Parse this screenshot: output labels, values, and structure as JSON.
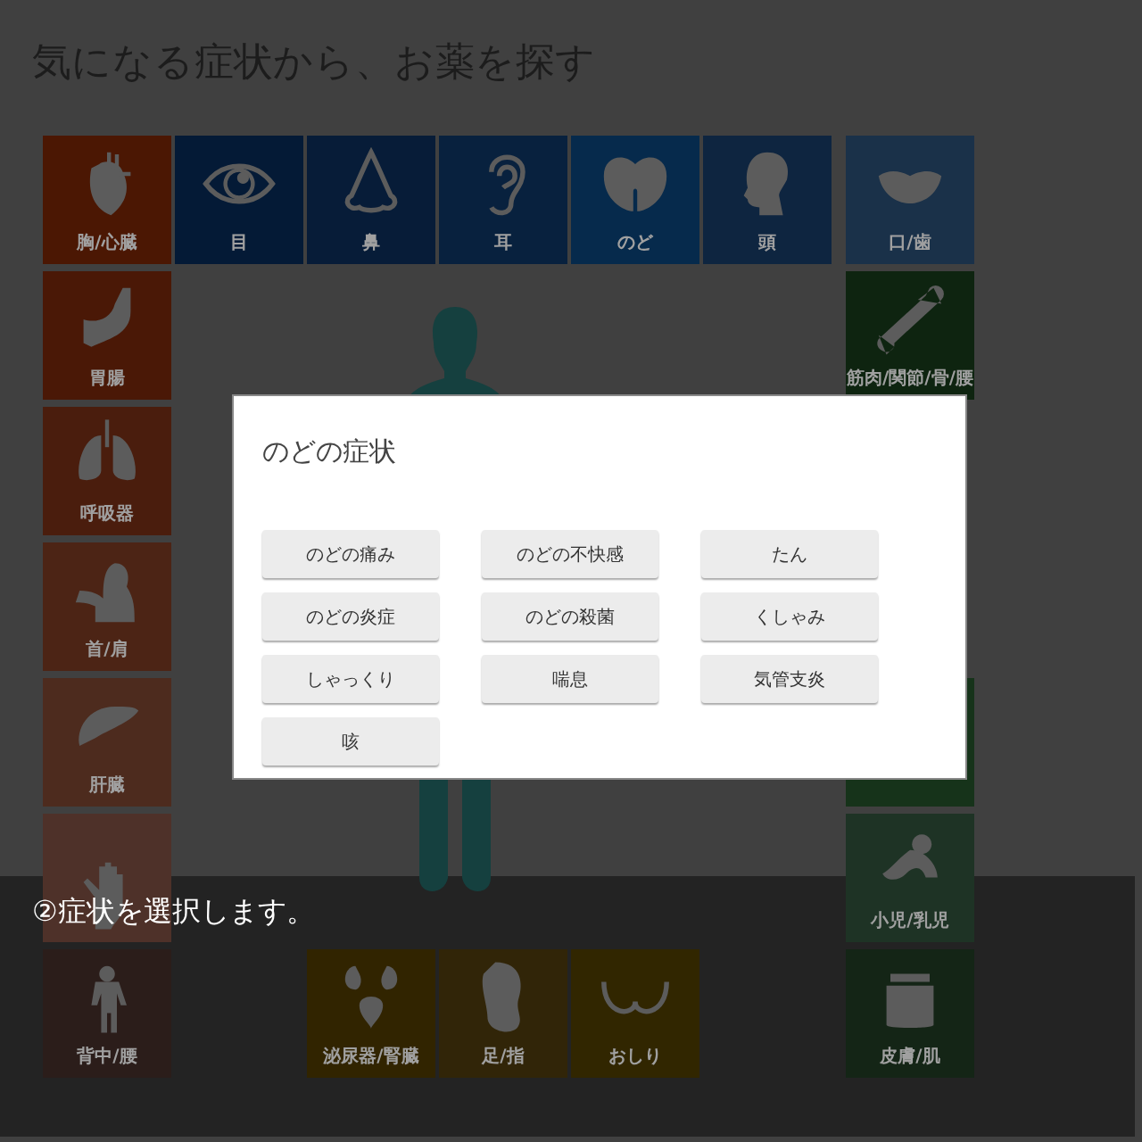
{
  "page_title": "気になる症状から、お薬を探す",
  "body_areas": {
    "left": [
      {
        "label": "胸/心臓",
        "color": "#4b1703"
      },
      {
        "label": "胃腸",
        "color": "#4a1806"
      },
      {
        "label": "呼吸器",
        "color": "#4a1d0d"
      },
      {
        "label": "首/肩",
        "color": "#4c2415"
      },
      {
        "label": "肝臓",
        "color": "#4d2b1e"
      },
      {
        "color": "#4e3129"
      },
      {
        "label": "背中/腰",
        "color": "#2b1d1a"
      }
    ],
    "top": [
      {
        "label": "目",
        "color": "#041a36"
      },
      {
        "label": "鼻",
        "color": "#071c38"
      },
      {
        "label": "耳",
        "color": "#08213e"
      },
      {
        "label": "のど",
        "color": "#062a4c"
      },
      {
        "label": "頭",
        "color": "#0e2540"
      }
    ],
    "right": [
      {
        "label": "口/歯",
        "color": "#1a3149"
      },
      {
        "label": "筋肉/関節/骨/腰",
        "color": "#0e2410"
      },
      {
        "color": "#16331a"
      },
      {
        "label": "小児/乳児",
        "color": "#1e3325"
      },
      {
        "label": "皮膚/肌",
        "color": "#142516"
      }
    ],
    "bottom": [
      {
        "label": "泌尿器/腎臓",
        "color": "#312400"
      },
      {
        "label": "足/指",
        "color": "#312508"
      },
      {
        "label": "おしり",
        "color": "#312600"
      }
    ]
  },
  "dialog": {
    "title": "のどの症状",
    "options": [
      "のどの痛み",
      "のどの不快感",
      "たん",
      "のどの炎症",
      "のどの殺菌",
      "くしゃみ",
      "しゃっくり",
      "喘息",
      "気管支炎",
      "咳"
    ]
  },
  "caption": "②症状を選択します。"
}
